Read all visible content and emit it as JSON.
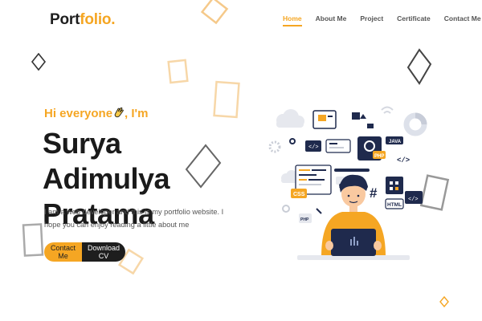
{
  "logo": {
    "main": "Port",
    "accent": "folio."
  },
  "nav": {
    "items": [
      {
        "label": "Home",
        "active": true
      },
      {
        "label": "About Me",
        "active": false
      },
      {
        "label": "Project",
        "active": false
      },
      {
        "label": "Certificate",
        "active": false
      },
      {
        "label": "Contact Me",
        "active": false
      }
    ]
  },
  "hero": {
    "greeting_prefix": "Hi everyone",
    "greeting_suffix": ", I'm",
    "name_line1": "Surya Adimulya",
    "name_line2": "Pratama",
    "description": "I am a web developer and this is my portfolio website. I hope you can enjoy reading a little about me",
    "contact_button": "Contact Me",
    "cv_button": "Download CV"
  },
  "illustration": {
    "tags": [
      "CSS",
      "HTML",
      "PHP",
      "JAVA",
      "</>",
      "#"
    ],
    "icon": "developer-illustration"
  },
  "colors": {
    "accent": "#f5a623",
    "dark": "#1e1e1e",
    "navy": "#1f2a4d"
  }
}
